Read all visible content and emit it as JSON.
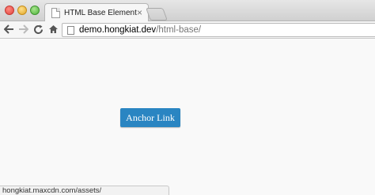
{
  "window": {
    "tab_title": "HTML Base Element",
    "tab_close": "×"
  },
  "toolbar": {
    "url_host": "demo.hongkiat.dev",
    "url_path": "/html-base/"
  },
  "page": {
    "anchor_label": "Anchor Link",
    "anchor_color": "#2a85c2"
  },
  "status": {
    "link_url": "hongkiat.maxcdn.com/assets/"
  },
  "icons": [
    "back-arrow-icon",
    "forward-arrow-icon",
    "reload-icon",
    "home-icon",
    "page-icon",
    "favicon-icon",
    "close-icon"
  ]
}
